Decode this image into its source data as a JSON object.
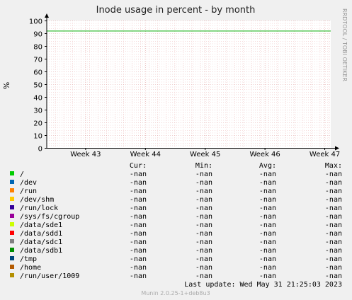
{
  "chart_data": {
    "type": "line",
    "title": "Inode usage in percent - by month",
    "ylabel": "%",
    "side_label": "RRDTOOL / TOBI OETIKER",
    "ylim": [
      0,
      100
    ],
    "yticks": [
      0,
      10,
      20,
      30,
      40,
      50,
      60,
      70,
      80,
      90,
      100
    ],
    "xticks": [
      "Week 43",
      "Week 44",
      "Week 45",
      "Week 46",
      "Week 47"
    ],
    "grid": true,
    "reference_line": {
      "value": 92,
      "color": "#00aa00"
    },
    "legend_headers": [
      "Cur:",
      "Min:",
      "Avg:",
      "Max:"
    ],
    "series": [
      {
        "name": "/",
        "color": "#00cc00",
        "cur": "-nan",
        "min": "-nan",
        "avg": "-nan",
        "max": "-nan"
      },
      {
        "name": "/dev",
        "color": "#0066b3",
        "cur": "-nan",
        "min": "-nan",
        "avg": "-nan",
        "max": "-nan"
      },
      {
        "name": "/run",
        "color": "#ff8000",
        "cur": "-nan",
        "min": "-nan",
        "avg": "-nan",
        "max": "-nan"
      },
      {
        "name": "/dev/shm",
        "color": "#ffcc00",
        "cur": "-nan",
        "min": "-nan",
        "avg": "-nan",
        "max": "-nan"
      },
      {
        "name": "/run/lock",
        "color": "#330099",
        "cur": "-nan",
        "min": "-nan",
        "avg": "-nan",
        "max": "-nan"
      },
      {
        "name": "/sys/fs/cgroup",
        "color": "#990099",
        "cur": "-nan",
        "min": "-nan",
        "avg": "-nan",
        "max": "-nan"
      },
      {
        "name": "/data/sde1",
        "color": "#ccff00",
        "cur": "-nan",
        "min": "-nan",
        "avg": "-nan",
        "max": "-nan"
      },
      {
        "name": "/data/sdd1",
        "color": "#ff0000",
        "cur": "-nan",
        "min": "-nan",
        "avg": "-nan",
        "max": "-nan"
      },
      {
        "name": "/data/sdc1",
        "color": "#808080",
        "cur": "-nan",
        "min": "-nan",
        "avg": "-nan",
        "max": "-nan"
      },
      {
        "name": "/data/sdb1",
        "color": "#008f00",
        "cur": "-nan",
        "min": "-nan",
        "avg": "-nan",
        "max": "-nan"
      },
      {
        "name": "/tmp",
        "color": "#00487d",
        "cur": "-nan",
        "min": "-nan",
        "avg": "-nan",
        "max": "-nan"
      },
      {
        "name": "/home",
        "color": "#b35a00",
        "cur": "-nan",
        "min": "-nan",
        "avg": "-nan",
        "max": "-nan"
      },
      {
        "name": "/run/user/1009",
        "color": "#b38f00",
        "cur": "-nan",
        "min": "-nan",
        "avg": "-nan",
        "max": "-nan"
      }
    ],
    "last_update": "Last update:  Wed May 31 21:25:03 2023",
    "footer": "Munin 2.0.25-1+deb8u3"
  }
}
